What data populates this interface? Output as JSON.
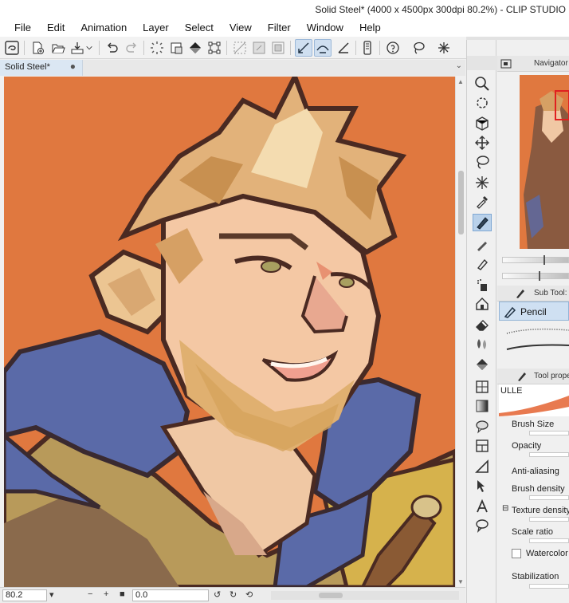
{
  "window": {
    "title": "Solid Steel* (4000 x 4500px 300dpi 80.2%) - CLIP STUDIO"
  },
  "menu": [
    "File",
    "Edit",
    "Animation",
    "Layer",
    "Select",
    "View",
    "Filter",
    "Window",
    "Help"
  ],
  "toolbar_icons": [
    "app-logo-icon",
    "new-file-icon",
    "open-file-icon",
    "save-icon",
    "undo-icon",
    "redo-icon",
    "deselect-icon",
    "clear-icon",
    "fill-icon",
    "transform-icon",
    "hide-selection-icon",
    "clear-outside-icon",
    "fill-selection-icon",
    "stabilize-icon",
    "line-icon",
    "ruler-icon",
    "smartphone-icon",
    "help-icon",
    "lasso-icon",
    "sparkle-icon"
  ],
  "document": {
    "tab_label": "Solid Steel*",
    "tab_marker": "●"
  },
  "status": {
    "zoom": "80.2",
    "rotation": "0.0"
  },
  "panels": {
    "navigator": {
      "title": "Navigator"
    },
    "subtool": {
      "title": "Sub Tool:",
      "selected": "Pencil"
    },
    "properties": {
      "title": "Tool prope",
      "brush_name": "ULLE",
      "items": [
        "Brush Size",
        "Opacity",
        "Anti-aliasing",
        "Brush density",
        "Texture density",
        "Scale ratio",
        "Watercolor",
        "Stabilization"
      ]
    }
  },
  "colors": {
    "canvas_bg": "#e0783f",
    "accent": "#cfe0f2",
    "hood": "#5a6aa8"
  }
}
